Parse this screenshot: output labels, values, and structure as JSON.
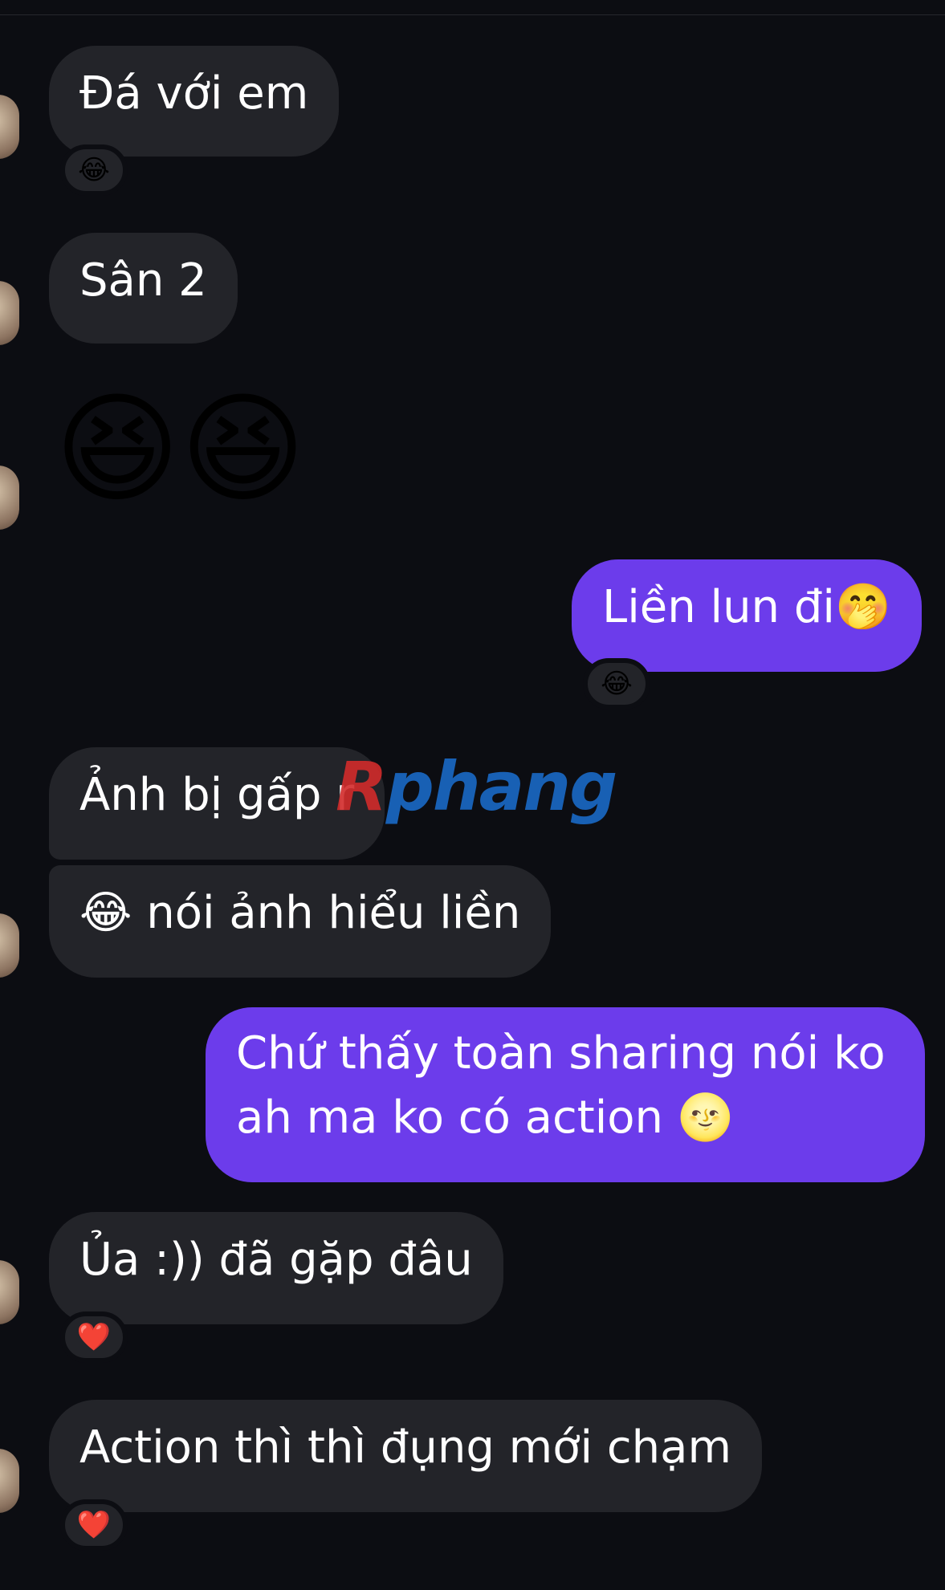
{
  "messages": [
    {
      "text": "Đá với em",
      "reaction": "😂"
    },
    {
      "text": "Sân 2"
    },
    {
      "emoji": "😆😆"
    },
    {
      "text": "Liền lun đi🤭",
      "reaction": "😂"
    },
    {
      "text": "Ảnh bị gấp r"
    },
    {
      "text": "😂 nói ảnh hiểu liền"
    },
    {
      "line1": "Chứ thấy toàn sharing nói ko",
      "line2": "ah ma ko có action 🌝"
    },
    {
      "text": "Ủa :)) đã gặp đâu",
      "reaction": "❤️"
    },
    {
      "text": "Action thì thì đụng mới chạm",
      "reaction": "❤️"
    }
  ],
  "watermark": {
    "part1": "R",
    "part2": "phang"
  },
  "colors": {
    "background": "#0c0d12",
    "incoming_bubble": "#232429",
    "outgoing_bubble": "#6c3ceb"
  }
}
